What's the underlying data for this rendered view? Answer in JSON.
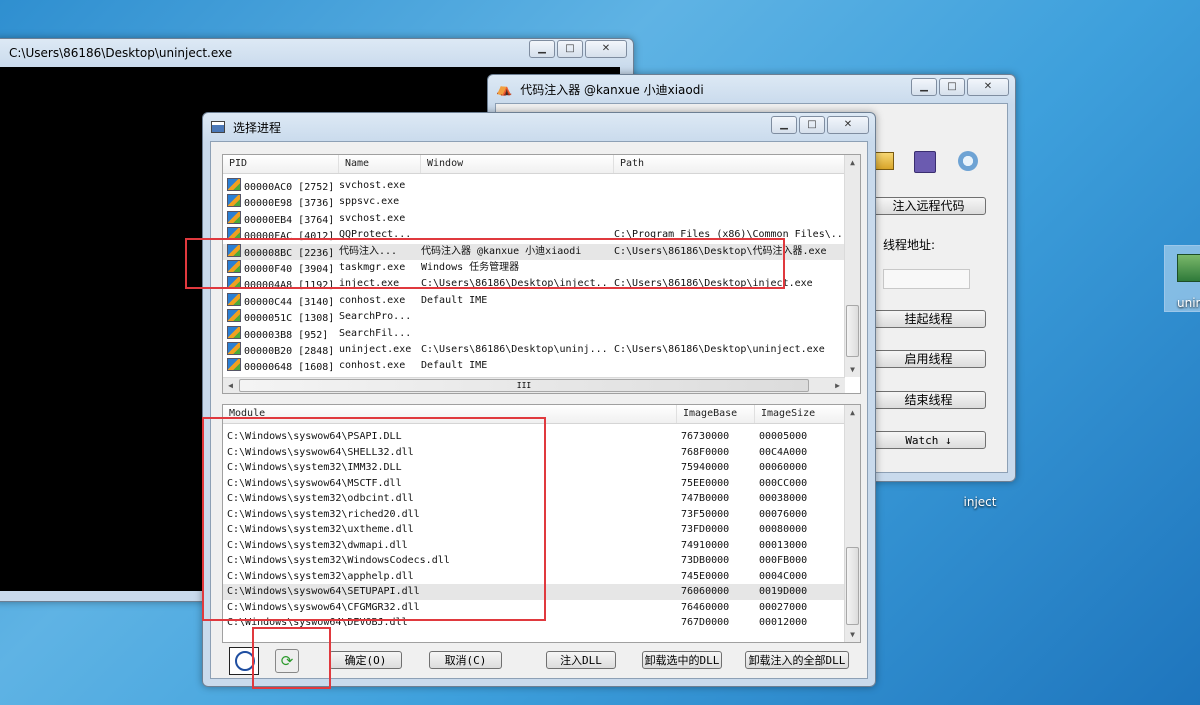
{
  "console_window": {
    "title": "C:\\Users\\86186\\Desktop\\uninject.exe"
  },
  "injector_window": {
    "title": "代码注入器 @kanxue 小迪xiaodi",
    "buttons": {
      "inject_remote": "注入远程代码",
      "suspend": "挂起线程",
      "resume": "启用线程",
      "terminate": "结束线程",
      "watch": "Watch ↓"
    },
    "thread_addr_label": "线程地址:"
  },
  "dialog": {
    "title": "选择进程",
    "process_columns": [
      "PID",
      "Name",
      "Window",
      "Path"
    ],
    "processes": [
      {
        "pid": "00000AC0 [2752]",
        "name": "svchost.exe",
        "window": "",
        "path": ""
      },
      {
        "pid": "00000E98 [3736]",
        "name": "sppsvc.exe",
        "window": "",
        "path": ""
      },
      {
        "pid": "00000EB4 [3764]",
        "name": "svchost.exe",
        "window": "",
        "path": ""
      },
      {
        "pid": "00000FAC [4012]",
        "name": "QQProtect...",
        "window": "",
        "path": "C:\\Program Files (x86)\\Common Files\\..."
      },
      {
        "pid": "000008BC [2236]",
        "name": "代码注入...",
        "window": "代码注入器 @kanxue 小迪xiaodi",
        "path": "C:\\Users\\86186\\Desktop\\代码注入器.exe"
      },
      {
        "pid": "00000F40 [3904]",
        "name": "taskmgr.exe",
        "window": "Windows 任务管理器",
        "path": ""
      },
      {
        "pid": "000004A8 [1192]",
        "name": "inject.exe",
        "window": "C:\\Users\\86186\\Desktop\\inject...",
        "path": "C:\\Users\\86186\\Desktop\\inject.exe"
      },
      {
        "pid": "00000C44 [3140]",
        "name": "conhost.exe",
        "window": "Default IME",
        "path": ""
      },
      {
        "pid": "0000051C [1308]",
        "name": "SearchPro...",
        "window": "",
        "path": ""
      },
      {
        "pid": "000003B8 [952]",
        "name": "SearchFil...",
        "window": "",
        "path": ""
      },
      {
        "pid": "00000B20 [2848]",
        "name": "uninject.exe",
        "window": "C:\\Users\\86186\\Desktop\\uninj...",
        "path": "C:\\Users\\86186\\Desktop\\uninject.exe"
      },
      {
        "pid": "00000648 [1608]",
        "name": "conhost.exe",
        "window": "Default IME",
        "path": ""
      }
    ],
    "hscroll_grip": "III",
    "module_columns": [
      "Module",
      "ImageBase",
      "ImageSize"
    ],
    "modules": [
      {
        "module": "C:\\Windows\\syswow64\\PSAPI.DLL",
        "base": "76730000",
        "size": "00005000"
      },
      {
        "module": "C:\\Windows\\syswow64\\SHELL32.dll",
        "base": "768F0000",
        "size": "00C4A000"
      },
      {
        "module": "C:\\Windows\\system32\\IMM32.DLL",
        "base": "75940000",
        "size": "00060000"
      },
      {
        "module": "C:\\Windows\\syswow64\\MSCTF.dll",
        "base": "75EE0000",
        "size": "000CC000"
      },
      {
        "module": "C:\\Windows\\system32\\odbcint.dll",
        "base": "747B0000",
        "size": "00038000"
      },
      {
        "module": "C:\\Windows\\system32\\riched20.dll",
        "base": "73F50000",
        "size": "00076000"
      },
      {
        "module": "C:\\Windows\\system32\\uxtheme.dll",
        "base": "73FD0000",
        "size": "00080000"
      },
      {
        "module": "C:\\Windows\\system32\\dwmapi.dll",
        "base": "74910000",
        "size": "00013000"
      },
      {
        "module": "C:\\Windows\\system32\\WindowsCodecs.dll",
        "base": "73DB0000",
        "size": "000FB000"
      },
      {
        "module": "C:\\Windows\\system32\\apphelp.dll",
        "base": "745E0000",
        "size": "0004C000"
      },
      {
        "module": "C:\\Windows\\syswow64\\SETUPAPI.dll",
        "base": "76060000",
        "size": "0019D000"
      },
      {
        "module": "C:\\Windows\\syswow64\\CFGMGR32.dll",
        "base": "76460000",
        "size": "00027000"
      },
      {
        "module": "C:\\Windows\\syswow64\\DEVOBJ.dll",
        "base": "767D0000",
        "size": "00012000"
      }
    ],
    "buttons": {
      "ok": "确定(O)",
      "cancel": "取消(C)",
      "inject_dll": "注入DLL",
      "unload_selected": "卸载选中的DLL",
      "unload_all": "卸载注入的全部DLL"
    }
  },
  "desktop": {
    "inject_label": "inject",
    "uninject_label": "unin"
  }
}
